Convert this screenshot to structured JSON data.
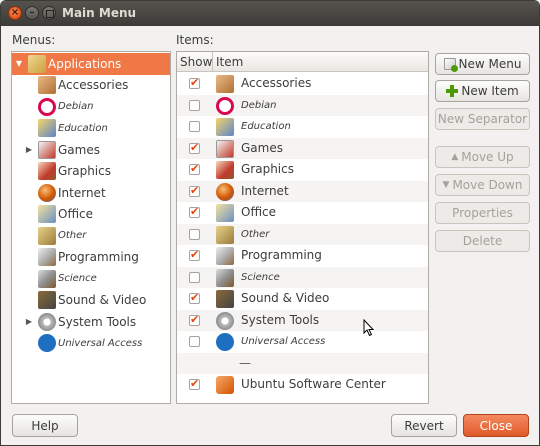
{
  "window": {
    "title": "Main Menu"
  },
  "labels": {
    "menus": "Menus:",
    "items": "Items:"
  },
  "menus_tree": [
    {
      "label": "Applications",
      "icon": "applications-icon",
      "italic": false,
      "expander": "▼",
      "selected": true,
      "level": 0
    },
    {
      "label": "Accessories",
      "icon": "accessories-icon",
      "italic": false,
      "expander": "",
      "selected": false,
      "level": 1
    },
    {
      "label": "Debian",
      "icon": "debian-icon",
      "italic": true,
      "expander": "",
      "selected": false,
      "level": 1
    },
    {
      "label": "Education",
      "icon": "education-icon",
      "italic": true,
      "expander": "",
      "selected": false,
      "level": 1
    },
    {
      "label": "Games",
      "icon": "games-icon",
      "italic": false,
      "expander": "▶",
      "selected": false,
      "level": 1
    },
    {
      "label": "Graphics",
      "icon": "graphics-icon",
      "italic": false,
      "expander": "",
      "selected": false,
      "level": 1
    },
    {
      "label": "Internet",
      "icon": "internet-icon",
      "italic": false,
      "expander": "",
      "selected": false,
      "level": 1
    },
    {
      "label": "Office",
      "icon": "office-icon",
      "italic": false,
      "expander": "",
      "selected": false,
      "level": 1
    },
    {
      "label": "Other",
      "icon": "other-icon",
      "italic": true,
      "expander": "",
      "selected": false,
      "level": 1
    },
    {
      "label": "Programming",
      "icon": "programming-icon",
      "italic": false,
      "expander": "",
      "selected": false,
      "level": 1
    },
    {
      "label": "Science",
      "icon": "science-icon",
      "italic": true,
      "expander": "",
      "selected": false,
      "level": 1
    },
    {
      "label": "Sound & Video",
      "icon": "sound-video-icon",
      "italic": false,
      "expander": "",
      "selected": false,
      "level": 1
    },
    {
      "label": "System Tools",
      "icon": "system-tools-icon",
      "italic": false,
      "expander": "▶",
      "selected": false,
      "level": 1
    },
    {
      "label": "Universal Access",
      "icon": "universal-access-icon",
      "italic": true,
      "expander": "",
      "selected": false,
      "level": 1
    }
  ],
  "items_table": {
    "headers": {
      "show": "Show",
      "item": "Item"
    },
    "rows": [
      {
        "label": "Accessories",
        "icon": "accessories-icon",
        "checked": true,
        "italic": false,
        "separator": false
      },
      {
        "label": "Debian",
        "icon": "debian-icon",
        "checked": false,
        "italic": true,
        "separator": false
      },
      {
        "label": "Education",
        "icon": "education-icon",
        "checked": false,
        "italic": true,
        "separator": false
      },
      {
        "label": "Games",
        "icon": "games-icon",
        "checked": true,
        "italic": false,
        "separator": false
      },
      {
        "label": "Graphics",
        "icon": "graphics-icon",
        "checked": true,
        "italic": false,
        "separator": false
      },
      {
        "label": "Internet",
        "icon": "internet-icon",
        "checked": true,
        "italic": false,
        "separator": false
      },
      {
        "label": "Office",
        "icon": "office-icon",
        "checked": true,
        "italic": false,
        "separator": false
      },
      {
        "label": "Other",
        "icon": "other-icon",
        "checked": false,
        "italic": true,
        "separator": false
      },
      {
        "label": "Programming",
        "icon": "programming-icon",
        "checked": true,
        "italic": false,
        "separator": false
      },
      {
        "label": "Science",
        "icon": "science-icon",
        "checked": false,
        "italic": true,
        "separator": false
      },
      {
        "label": "Sound & Video",
        "icon": "sound-video-icon",
        "checked": true,
        "italic": false,
        "separator": false
      },
      {
        "label": "System Tools",
        "icon": "system-tools-icon",
        "checked": true,
        "italic": false,
        "separator": false
      },
      {
        "label": "Universal Access",
        "icon": "universal-access-icon",
        "checked": false,
        "italic": true,
        "separator": false
      },
      {
        "label": "—",
        "icon": "",
        "checked": false,
        "italic": false,
        "separator": true
      },
      {
        "label": "Ubuntu Software Center",
        "icon": "ubuntu-software-center-icon",
        "checked": true,
        "italic": false,
        "separator": false
      }
    ]
  },
  "side_buttons": {
    "new_menu": "New Menu",
    "new_item": "New Item",
    "new_separator": "New Separator",
    "move_up": "Move Up",
    "move_down": "Move Down",
    "properties": "Properties",
    "delete": "Delete"
  },
  "footer_buttons": {
    "help": "Help",
    "revert": "Revert",
    "close": "Close"
  },
  "colors": {
    "selection": "#f07746",
    "check": "#dd4814",
    "close_button": "#e05a2a"
  }
}
